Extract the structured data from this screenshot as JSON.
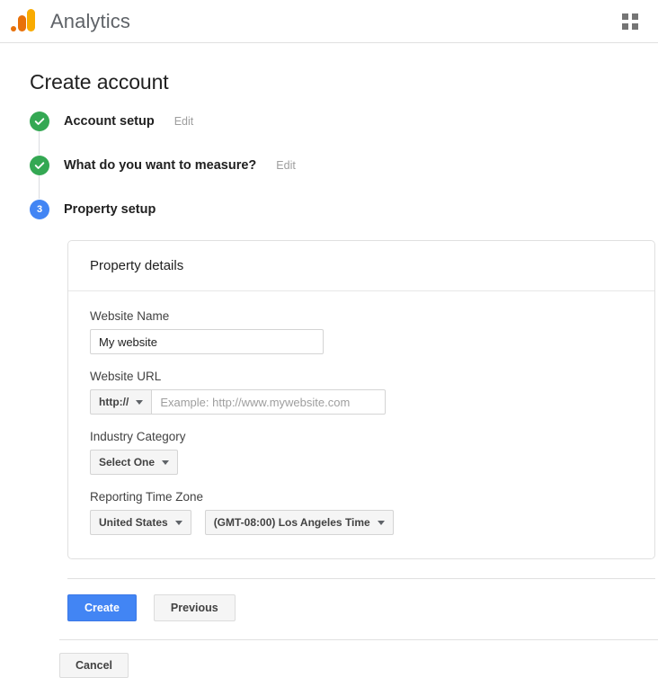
{
  "header": {
    "app_title": "Analytics",
    "logo_icon": "google-analytics-logo",
    "apps_icon": "apps-grid-icon",
    "logo_colors": {
      "tall_bar": "#f9ab00",
      "mid_bar": "#e8710a",
      "dot": "#e8710a"
    }
  },
  "page": {
    "title": "Create account"
  },
  "stepper": {
    "steps": [
      {
        "label": "Account setup",
        "state": "done",
        "marker": "check-icon",
        "edit_label": "Edit",
        "has_edit": true
      },
      {
        "label": "What do you want to measure?",
        "state": "done",
        "marker": "check-icon",
        "edit_label": "Edit",
        "has_edit": true
      },
      {
        "label": "Property setup",
        "state": "current",
        "marker": "3",
        "edit_label": "",
        "has_edit": false
      }
    ],
    "colors": {
      "done": "#34a853",
      "current": "#4285f4"
    }
  },
  "card": {
    "title": "Property details",
    "fields": {
      "website_name": {
        "label": "Website Name",
        "value": "My website",
        "placeholder": ""
      },
      "website_url": {
        "label": "Website URL",
        "protocol": "http://",
        "value": "",
        "placeholder": "Example: http://www.mywebsite.com"
      },
      "industry_category": {
        "label": "Industry Category",
        "value": "Select One"
      },
      "reporting_time_zone": {
        "label": "Reporting Time Zone",
        "country": "United States",
        "zone": "(GMT-08:00) Los Angeles Time"
      }
    }
  },
  "actions": {
    "create_label": "Create",
    "previous_label": "Previous",
    "create_color": "#4285f4"
  },
  "footer": {
    "cancel_label": "Cancel"
  }
}
